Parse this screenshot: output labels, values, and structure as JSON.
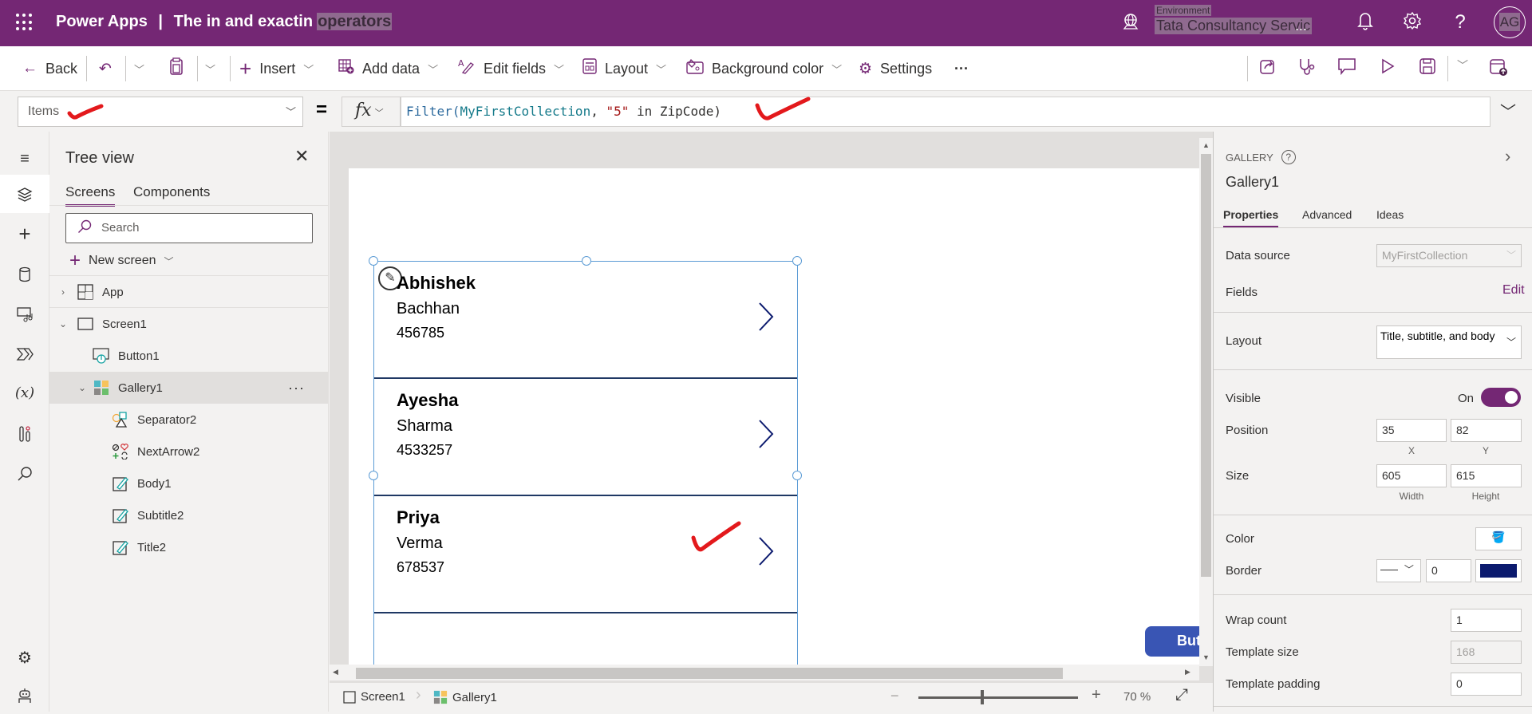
{
  "topbar": {
    "app_name": "Power Apps",
    "separator": "|",
    "doc_title_plain": "The in and exactin",
    "doc_title_highlight": "operators",
    "environment_label": "Environment",
    "environment_value": "Tata Consultancy Servic",
    "environment_ellipsis": "...",
    "avatar_initials": "AG",
    "icons": [
      "waffle-icon",
      "environment-icon",
      "notifications-icon",
      "settings-icon",
      "help-icon"
    ]
  },
  "toolbar": {
    "back": "Back",
    "insert": "Insert",
    "add_data": "Add data",
    "edit_fields": "Edit fields",
    "layout": "Layout",
    "background_color": "Background color",
    "settings": "Settings",
    "more": "···"
  },
  "formula_bar": {
    "property": "Items",
    "equals": "=",
    "fx": "fx",
    "formula": {
      "fn": "Filter(",
      "collection": "MyFirstCollection",
      "comma": ", ",
      "string": "\"5\"",
      "rest": " in ZipCode)"
    }
  },
  "tree_view": {
    "title": "Tree view",
    "tabs": [
      "Screens",
      "Components"
    ],
    "active_tab": "Screens",
    "search_placeholder": "Search",
    "new_screen": "New screen",
    "nodes": [
      {
        "label": "App",
        "level": 0,
        "expanded": false
      },
      {
        "label": "Screen1",
        "level": 0,
        "expanded": true
      },
      {
        "label": "Button1",
        "level": 1
      },
      {
        "label": "Gallery1",
        "level": 1,
        "expanded": true,
        "selected": true
      },
      {
        "label": "Separator2",
        "level": 2
      },
      {
        "label": "NextArrow2",
        "level": 2
      },
      {
        "label": "Body1",
        "level": 2
      },
      {
        "label": "Subtitle2",
        "level": 2
      },
      {
        "label": "Title2",
        "level": 2
      }
    ]
  },
  "gallery": {
    "items": [
      {
        "title": "Abhishek",
        "subtitle": "Bachhan",
        "body": "456785"
      },
      {
        "title": "Ayesha",
        "subtitle": "Sharma",
        "body": "4533257"
      },
      {
        "title": "Priya",
        "subtitle": "Verma",
        "body": "678537"
      }
    ]
  },
  "canvas": {
    "button_label": "Button"
  },
  "status_bar": {
    "screen": "Screen1",
    "control": "Gallery1",
    "zoom_percent": "70",
    "zoom_unit": "%",
    "zoom_value": 70
  },
  "properties_panel": {
    "control_type": "GALLERY",
    "control_name": "Gallery1",
    "tabs": [
      "Properties",
      "Advanced",
      "Ideas"
    ],
    "active_tab": "Properties",
    "data_source_label": "Data source",
    "data_source_value": "MyFirstCollection",
    "fields_label": "Fields",
    "fields_edit": "Edit",
    "layout_label": "Layout",
    "layout_value": "Title, subtitle, and body",
    "visible_label": "Visible",
    "visible_state": "On",
    "position_label": "Position",
    "position_x": "35",
    "position_y": "82",
    "x_caption": "X",
    "y_caption": "Y",
    "size_label": "Size",
    "size_width": "605",
    "size_height": "615",
    "width_caption": "Width",
    "height_caption": "Height",
    "color_label": "Color",
    "border_label": "Border",
    "border_width": "0",
    "border_color": "#0b1a6e",
    "wrap_count_label": "Wrap count",
    "wrap_count": "1",
    "template_size_label": "Template size",
    "template_size": "168",
    "template_padding_label": "Template padding",
    "template_padding": "0"
  },
  "colors": {
    "brand": "#742774",
    "selection": "#5b9bd5",
    "annotation_red": "#e3191c"
  }
}
